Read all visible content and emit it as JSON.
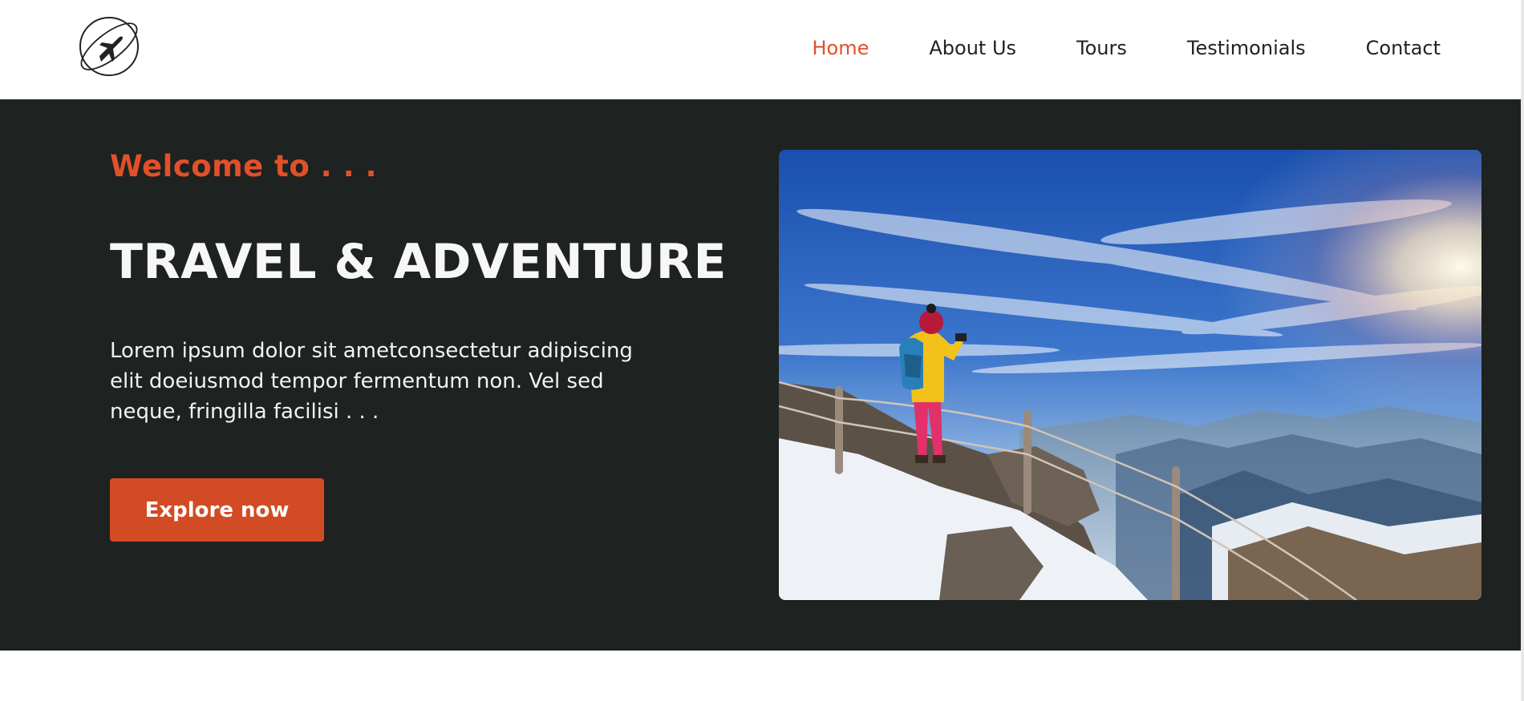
{
  "header": {
    "logo_icon": "globe-airplane-icon",
    "nav": [
      {
        "label": "Home",
        "active": true
      },
      {
        "label": "About Us",
        "active": false
      },
      {
        "label": "Tours",
        "active": false
      },
      {
        "label": "Testimonials",
        "active": false
      },
      {
        "label": "Contact",
        "active": false
      }
    ]
  },
  "hero": {
    "welcome": "Welcome to . . .",
    "title": "TRAVEL & ADVENTURE",
    "description": "Lorem ipsum dolor sit ametconsectetur adipiscing elit doeiusmod tempor fermentum non. Vel sed neque, fringilla facilisi . . .",
    "cta_label": "Explore now",
    "image_icon": "hiker-mountain-photo"
  },
  "colors": {
    "accent": "#e2502a",
    "button": "#d24b24",
    "hero_bg": "#1e2220",
    "nav_text": "#222222",
    "hero_text": "#f7f7f7"
  }
}
